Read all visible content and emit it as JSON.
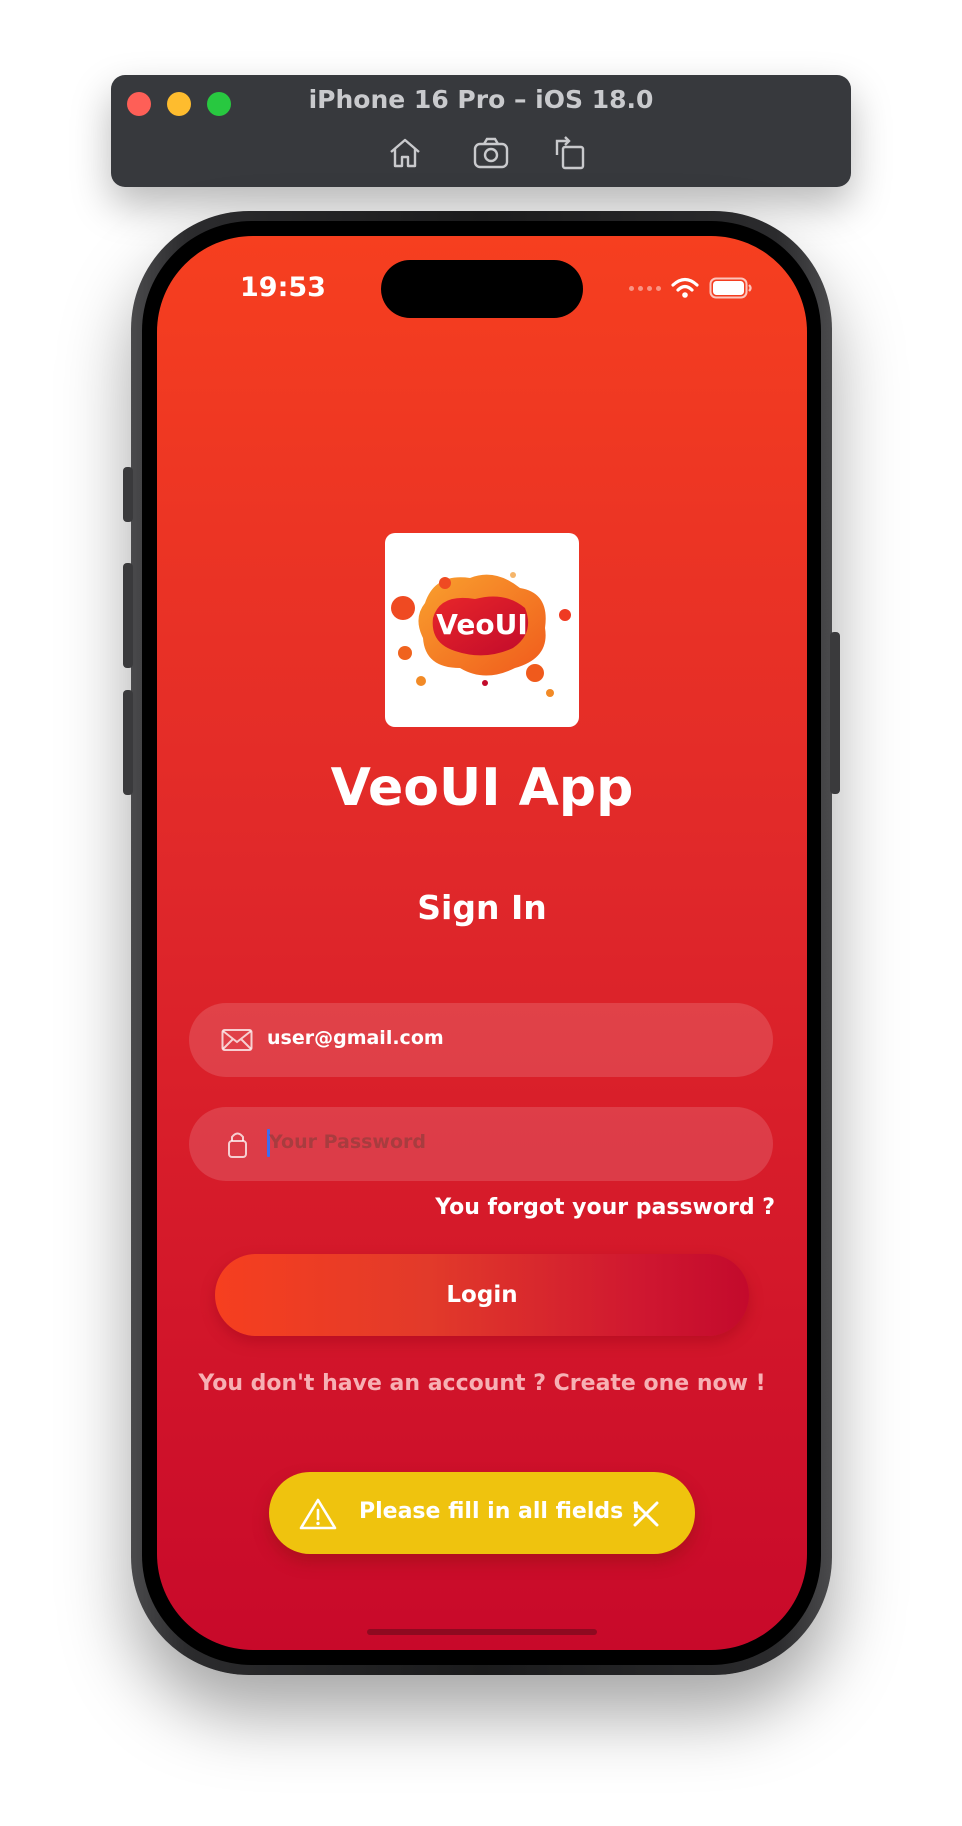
{
  "simulator": {
    "title": "iPhone 16 Pro – iOS 18.0",
    "tools": [
      {
        "name": "home-icon"
      },
      {
        "name": "screenshot-icon"
      },
      {
        "name": "rotate-icon"
      }
    ]
  },
  "status_bar": {
    "time": "19:53",
    "icons": [
      "cellular-signal-icon",
      "wifi-icon",
      "battery-icon"
    ]
  },
  "app": {
    "logo_text": "VeoUI",
    "title": "VeoUI App"
  },
  "form": {
    "heading": "Sign In",
    "email": {
      "value": "user@gmail.com",
      "icon": "envelope-icon"
    },
    "password": {
      "value": "",
      "placeholder": "Your Password",
      "icon": "lock-icon"
    },
    "forgot_link": "You forgot your password ?",
    "login_label": "Login",
    "create_account": "You don't have an account ? Create one now !"
  },
  "toast": {
    "message": "Please fill in all fields !",
    "icon": "warning-icon",
    "close_icon": "close-icon",
    "color": "#efc30e"
  },
  "colors": {
    "gradient_top": "#f63f1f",
    "gradient_bottom": "#c8092a",
    "toast": "#efc30e",
    "caret": "#3e6cf0"
  }
}
